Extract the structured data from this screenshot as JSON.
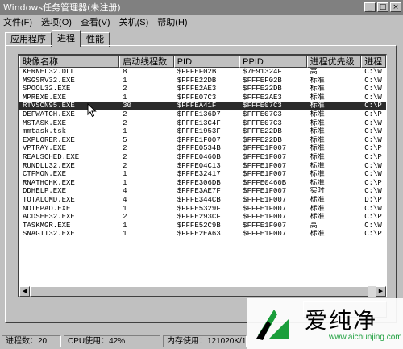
{
  "window": {
    "title": "Windows任务管理器(未注册)",
    "min_glyph": "_",
    "max_glyph": "□",
    "close_glyph": "×"
  },
  "menu": [
    "文件(F)",
    "选项(O)",
    "查看(V)",
    "关机(S)",
    "帮助(H)"
  ],
  "tabs": [
    {
      "label": "应用程序",
      "active": false
    },
    {
      "label": "进程",
      "active": true
    },
    {
      "label": "性能",
      "active": false
    }
  ],
  "columns": [
    "映像名称",
    "启动线程数",
    "PID",
    "PPID",
    "进程优先级",
    "进程"
  ],
  "rows": [
    [
      "KERNEL32.DLL",
      "8",
      "$FFFEF02B",
      "$7E91324F",
      "高",
      "C:\\W"
    ],
    [
      "MSGSRV32.EXE",
      "1",
      "$FFFE22DB",
      "$FFFEF02B",
      "标准",
      "C:\\W"
    ],
    [
      "SPOOL32.EXE",
      "2",
      "$FFFE2AE3",
      "$FFFE22DB",
      "标准",
      "C:\\W"
    ],
    [
      "MPREXE.EXE",
      "1",
      "$FFFE07C3",
      "$FFFE2AE3",
      "标准",
      "C:\\W"
    ],
    [
      "RTVSCN95.EXE",
      "30",
      "$FFFEA41F",
      "$FFFE07C3",
      "标准",
      "C:\\P"
    ],
    [
      "DEFWATCH.EXE",
      "2",
      "$FFFE136D7",
      "$FFFE07C3",
      "标准",
      "C:\\P"
    ],
    [
      "MSTASK.EXE",
      "2",
      "$FFFE13C4F",
      "$FFFE07C3",
      "标准",
      "C:\\W"
    ],
    [
      "mmtask.tsk",
      "1",
      "$FFFE1953F",
      "$FFFE22DB",
      "标准",
      "C:\\W"
    ],
    [
      "EXPLORER.EXE",
      "5",
      "$FFFE1F007",
      "$FFFE22DB",
      "标准",
      "C:\\W"
    ],
    [
      "VPTRAY.EXE",
      "2",
      "$FFFE0534B",
      "$FFFE1F007",
      "标准",
      "C:\\P"
    ],
    [
      "REALSCHED.EXE",
      "2",
      "$FFFE0460B",
      "$FFFE1F007",
      "标准",
      "C:\\P"
    ],
    [
      "RUNDLL32.EXE",
      "2",
      "$FFFE04C13",
      "$FFFE1F007",
      "标准",
      "C:\\W"
    ],
    [
      "CTFMON.EXE",
      "1",
      "$FFFE32417",
      "$FFFE1F007",
      "标准",
      "C:\\W"
    ],
    [
      "RNATHCHK.EXE",
      "1",
      "$FFFE306DB",
      "$FFFE0460B",
      "标准",
      "C:\\P"
    ],
    [
      "DDHELP.EXE",
      "4",
      "$FFFE3AE7F",
      "$FFFE1F007",
      "实时",
      "C:\\W"
    ],
    [
      "TOTALCMD.EXE",
      "4",
      "$FFFE344CB",
      "$FFFE1F007",
      "标准",
      "D:\\P"
    ],
    [
      "NOTEPAD.EXE",
      "1",
      "$FFFE5329F",
      "$FFFE1F007",
      "标准",
      "C:\\W"
    ],
    [
      "ACDSEE32.EXE",
      "2",
      "$FFFE293CF",
      "$FFFE1F007",
      "标准",
      "C:\\P"
    ],
    [
      "TASKMGR.EXE",
      "1",
      "$FFFE52C9B",
      "$FFFE1F007",
      "高",
      "C:\\W"
    ],
    [
      "SNAGIT32.EXE",
      "1",
      "$FFFE2EA63",
      "$FFFE1F007",
      "标准",
      "C:\\P"
    ]
  ],
  "selected_row": 4,
  "scroll": {
    "left_glyph": "◀",
    "right_glyph": "▶"
  },
  "status": {
    "processes": "进程数：20",
    "cpu": "CPU使用：42%",
    "memory": "内存使用：121020K/12230"
  },
  "watermark": {
    "text": "爱纯净",
    "url": "www.aichunjing.com",
    "color": "#1a9e3b"
  }
}
